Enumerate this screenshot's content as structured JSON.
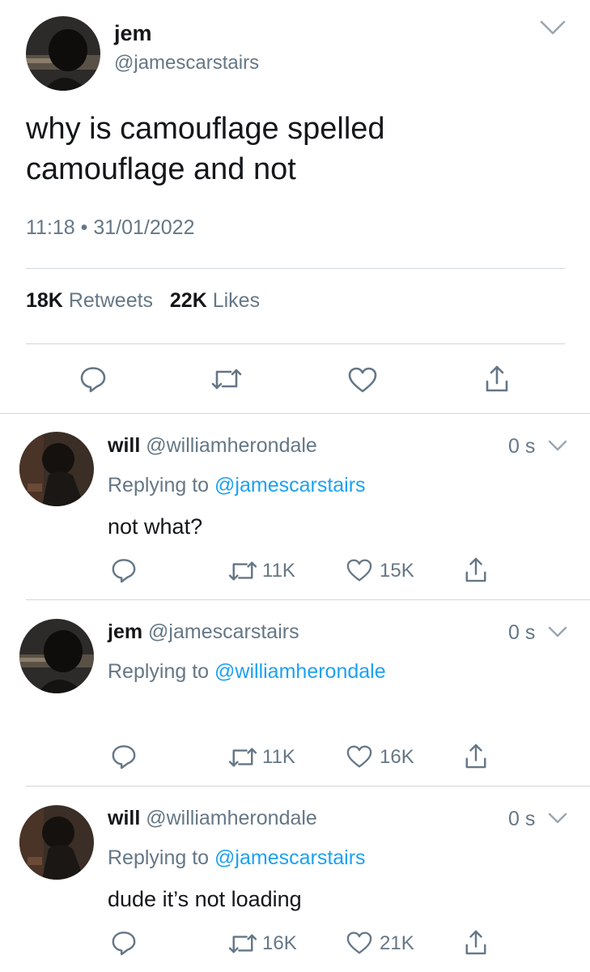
{
  "main_tweet": {
    "display_name": "jem",
    "handle": "@jamescarstairs",
    "text_line1": "why is camouflage spelled",
    "text_line2": "camouflage and not",
    "timestamp": "11:18 • 31/01/2022",
    "retweets_count": "18K",
    "retweets_label": "Retweets",
    "likes_count": "22K",
    "likes_label": "Likes"
  },
  "replies": [
    {
      "display_name": "will",
      "handle": "@williamherondale",
      "time": "0 s",
      "replying_prefix": "Replying to",
      "replying_to": "@jamescarstairs",
      "text": "not what?",
      "retweets": "11K",
      "likes": "15K"
    },
    {
      "display_name": "jem",
      "handle": "@jamescarstairs",
      "time": "0 s",
      "replying_prefix": "Replying to",
      "replying_to": "@williamherondale",
      "text": "",
      "retweets": "11K",
      "likes": "16K"
    },
    {
      "display_name": "will",
      "handle": "@williamherondale",
      "time": "0 s",
      "replying_prefix": "Replying to",
      "replying_to": "@jamescarstairs",
      "text": "dude it’s not loading",
      "retweets": "16K",
      "likes": "21K"
    }
  ],
  "colors": {
    "text": "#14171a",
    "secondary": "#657786",
    "link": "#1da1f2",
    "divider": "#cfd6dc"
  },
  "icons": [
    "chevron-down-icon",
    "reply-icon",
    "retweet-icon",
    "like-icon",
    "share-icon"
  ]
}
